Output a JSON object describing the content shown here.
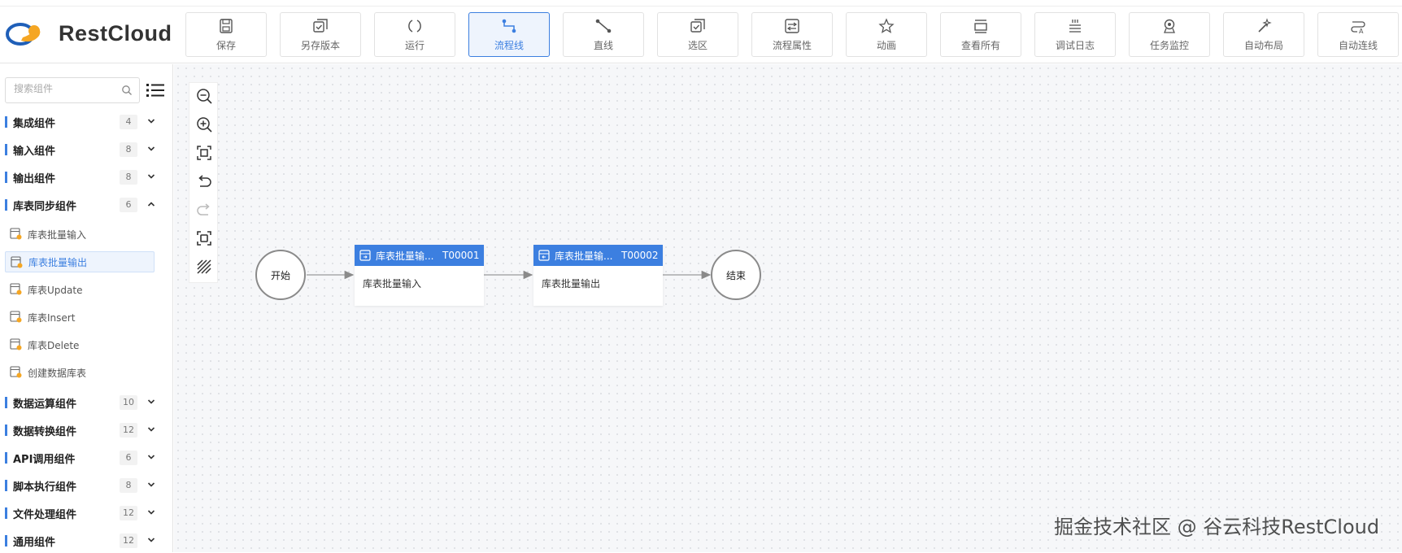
{
  "app": {
    "title": "RestCloud"
  },
  "toolbar": [
    {
      "label": "保存",
      "icon": "save-icon",
      "active": false
    },
    {
      "label": "另存版本",
      "icon": "save-version-icon",
      "active": false
    },
    {
      "label": "运行",
      "icon": "run-icon",
      "active": false
    },
    {
      "label": "流程线",
      "icon": "flow-line-icon",
      "active": true
    },
    {
      "label": "直线",
      "icon": "straight-line-icon",
      "active": false
    },
    {
      "label": "选区",
      "icon": "select-area-icon",
      "active": false
    },
    {
      "label": "流程属性",
      "icon": "flow-properties-icon",
      "active": false
    },
    {
      "label": "动画",
      "icon": "animation-icon",
      "active": false
    },
    {
      "label": "查看所有",
      "icon": "view-all-icon",
      "active": false
    },
    {
      "label": "调试日志",
      "icon": "debug-log-icon",
      "active": false
    },
    {
      "label": "任务监控",
      "icon": "task-monitor-icon",
      "active": false
    },
    {
      "label": "自动布局",
      "icon": "auto-layout-icon",
      "active": false
    },
    {
      "label": "自动连线",
      "icon": "auto-connect-icon",
      "active": false
    }
  ],
  "sidebar": {
    "search_placeholder": "搜索组件",
    "categories_top": [
      {
        "name": "集成组件",
        "count": "4",
        "expanded": false
      },
      {
        "name": "输入组件",
        "count": "8",
        "expanded": false
      },
      {
        "name": "输出组件",
        "count": "8",
        "expanded": false
      },
      {
        "name": "库表同步组件",
        "count": "6",
        "expanded": true
      }
    ],
    "items": [
      {
        "name": "库表批量输入",
        "selected": false
      },
      {
        "name": "库表批量输出",
        "selected": true
      },
      {
        "name": "库表Update",
        "selected": false
      },
      {
        "name": "库表Insert",
        "selected": false
      },
      {
        "name": "库表Delete",
        "selected": false
      },
      {
        "name": "创建数据库表",
        "selected": false
      }
    ],
    "categories_bottom": [
      {
        "name": "数据运算组件",
        "count": "10",
        "expanded": false
      },
      {
        "name": "数据转换组件",
        "count": "12",
        "expanded": false
      },
      {
        "name": "API调用组件",
        "count": "6",
        "expanded": false
      },
      {
        "name": "脚本执行组件",
        "count": "8",
        "expanded": false
      },
      {
        "name": "文件处理组件",
        "count": "12",
        "expanded": false
      },
      {
        "name": "通用组件",
        "count": "12",
        "expanded": false
      }
    ]
  },
  "canvas_tools": [
    "zoom-out-icon",
    "zoom-in-icon",
    "fit-view-icon",
    "undo-icon",
    "redo-icon",
    "fullscreen-icon",
    "grid-toggle-icon"
  ],
  "flow": {
    "start_label": "开始",
    "end_label": "结束",
    "tasks": [
      {
        "title": "库表批量输...",
        "id": "T00001",
        "body": "库表批量输入"
      },
      {
        "title": "库表批量输...",
        "id": "T00002",
        "body": "库表批量输出"
      }
    ]
  },
  "watermark": "掘金技术社区 @ 谷云科技RestCloud",
  "colors": {
    "accent": "#3c7fe0",
    "node_border": "#8a8a8a",
    "canvas_bg": "#f6f7f9"
  }
}
